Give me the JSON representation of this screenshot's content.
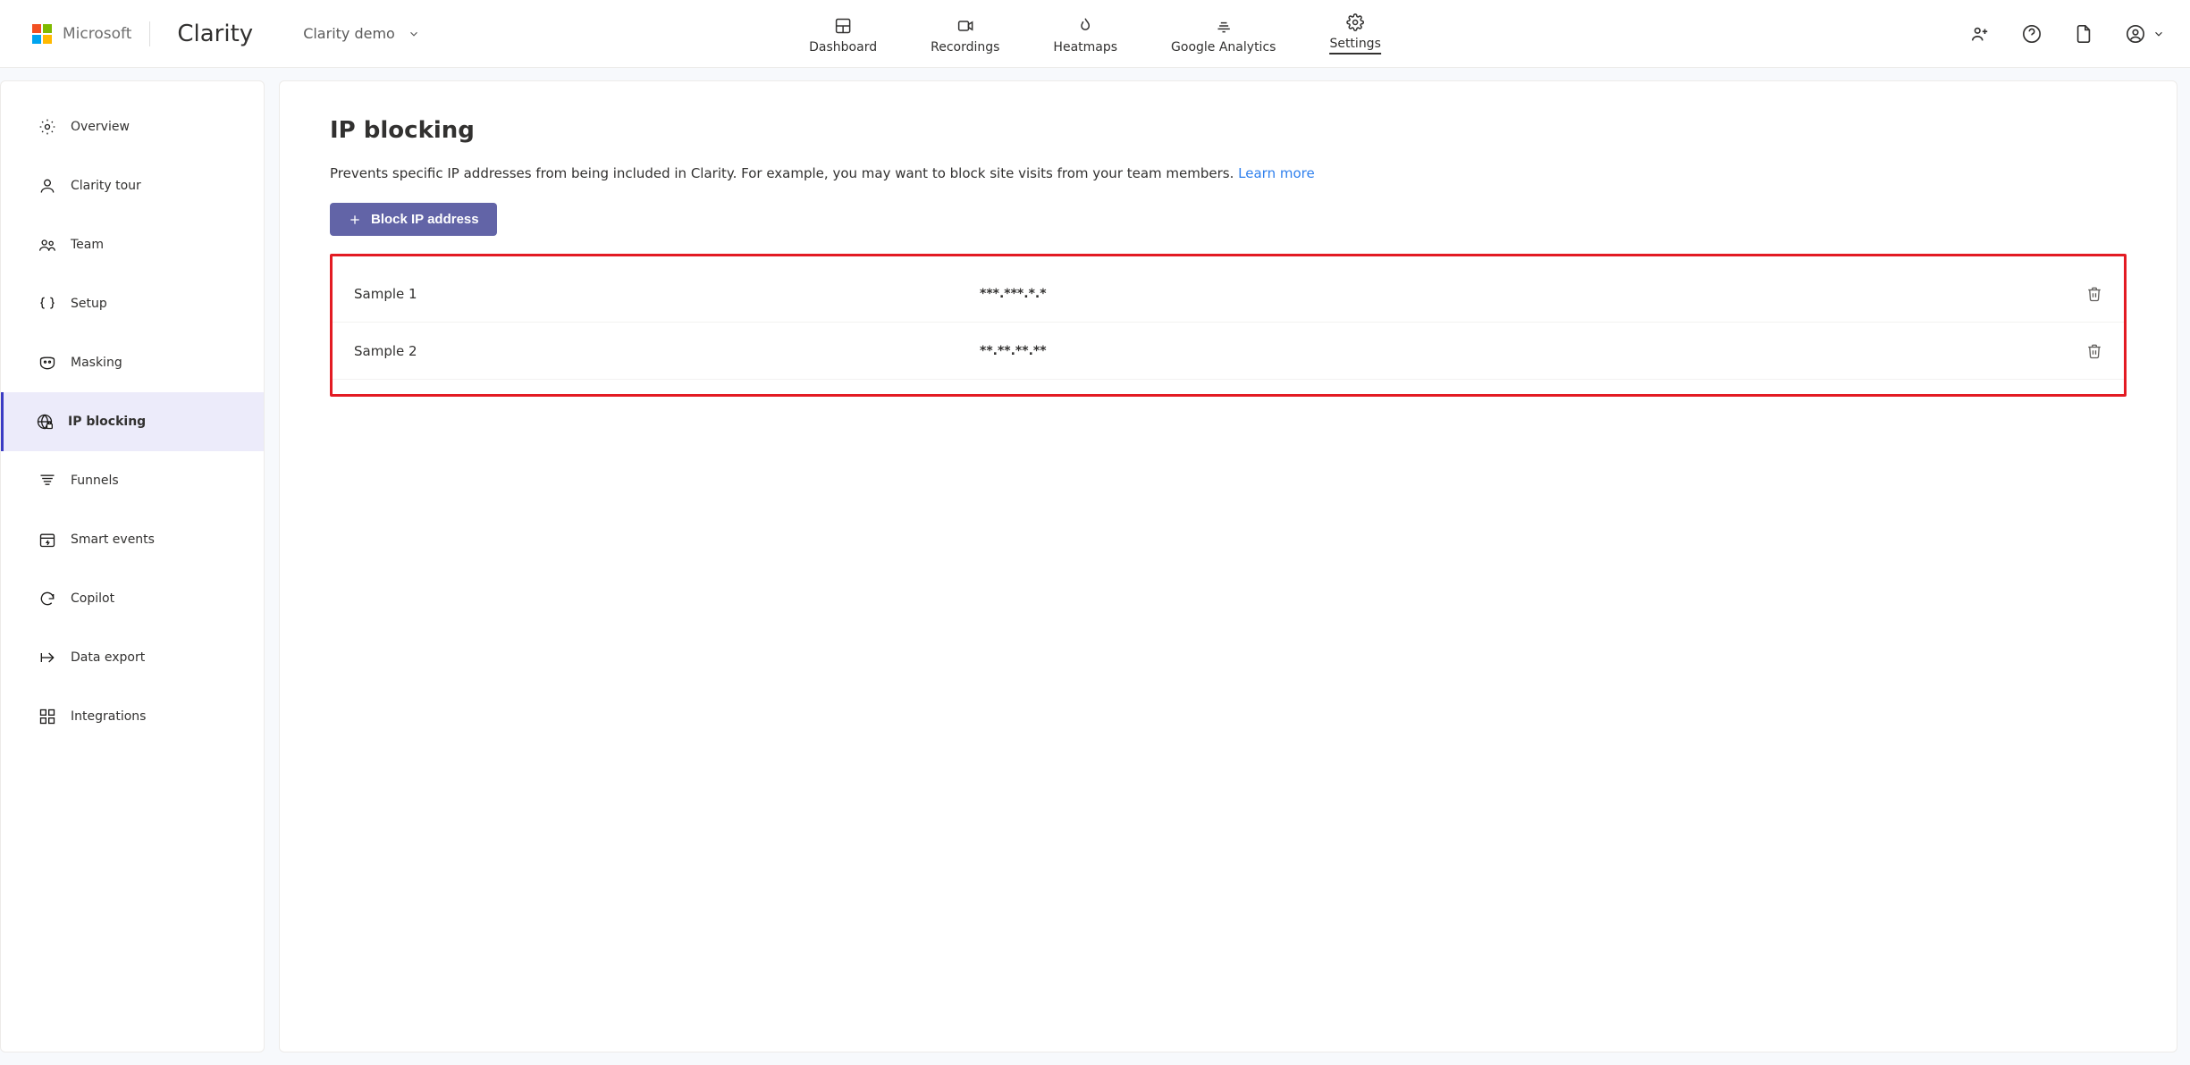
{
  "header": {
    "org": "Microsoft",
    "product": "Clarity",
    "project": "Clarity demo",
    "nav": [
      {
        "label": "Dashboard"
      },
      {
        "label": "Recordings"
      },
      {
        "label": "Heatmaps"
      },
      {
        "label": "Google Analytics"
      },
      {
        "label": "Settings"
      }
    ],
    "active_nav": "Settings"
  },
  "sidebar": {
    "items": [
      {
        "label": "Overview",
        "icon": "gear"
      },
      {
        "label": "Clarity tour",
        "icon": "user-outline"
      },
      {
        "label": "Team",
        "icon": "people"
      },
      {
        "label": "Setup",
        "icon": "braces"
      },
      {
        "label": "Masking",
        "icon": "mask"
      },
      {
        "label": "IP blocking",
        "icon": "globe-lock",
        "active": true
      },
      {
        "label": "Funnels",
        "icon": "funnel"
      },
      {
        "label": "Smart events",
        "icon": "calendar-bolt"
      },
      {
        "label": "Copilot",
        "icon": "refresh"
      },
      {
        "label": "Data export",
        "icon": "arrow-right"
      },
      {
        "label": "Integrations",
        "icon": "grid"
      }
    ]
  },
  "page": {
    "title": "IP blocking",
    "description": "Prevents specific IP addresses from being included in Clarity. For example, you may want to block site visits from your team members. ",
    "learn_more": "Learn more",
    "button": "Block IP address",
    "rows": [
      {
        "name": "Sample 1",
        "ip": "***.***.*.*"
      },
      {
        "name": "Sample 2",
        "ip": "**.**.**.**"
      }
    ]
  }
}
